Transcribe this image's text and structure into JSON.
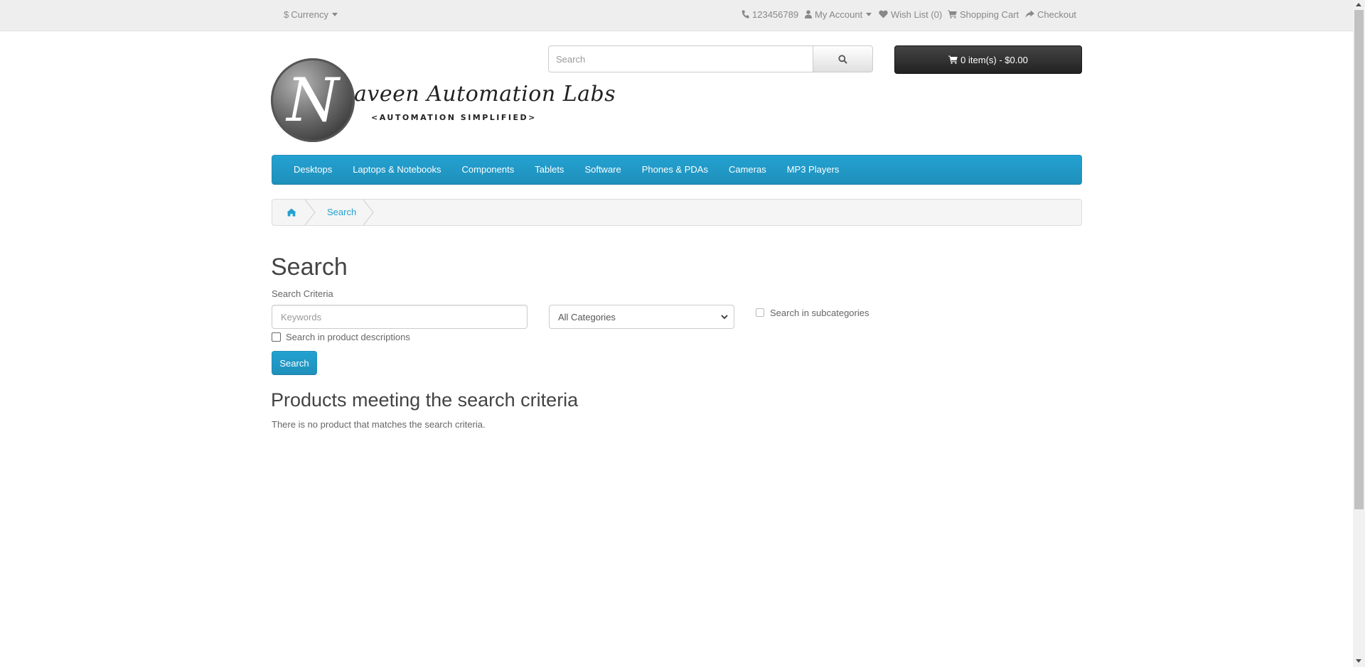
{
  "topbar": {
    "currency_symbol": "$",
    "currency_label": "Currency",
    "phone": "123456789",
    "my_account": "My Account",
    "wish_list": "Wish List (0)",
    "shopping_cart": "Shopping Cart",
    "checkout": "Checkout"
  },
  "logo": {
    "letter": "N",
    "name": "aveen Automation Labs",
    "tagline": "<AUTOMATION SIMPLIFIED>"
  },
  "header_search": {
    "placeholder": "Search",
    "button_icon": "search-icon"
  },
  "cart_button": {
    "label": "0 item(s) - $0.00",
    "icon": "shopping-cart-icon"
  },
  "menu": {
    "items": [
      {
        "label": "Desktops"
      },
      {
        "label": "Laptops & Notebooks"
      },
      {
        "label": "Components"
      },
      {
        "label": "Tablets"
      },
      {
        "label": "Software"
      },
      {
        "label": "Phones & PDAs"
      },
      {
        "label": "Cameras"
      },
      {
        "label": "MP3 Players"
      }
    ]
  },
  "breadcrumb": {
    "home_icon": "home-icon",
    "current": "Search"
  },
  "page": {
    "title": "Search",
    "criteria_label": "Search Criteria",
    "keywords_placeholder": "Keywords",
    "category_selected": "All Categories",
    "subcategories_label": "Search in subcategories",
    "subcategories_checked": false,
    "descriptions_label": "Search in product descriptions",
    "descriptions_checked": false,
    "search_button": "Search",
    "results_title": "Products meeting the search criteria",
    "no_results": "There is no product that matches the search criteria."
  },
  "colors": {
    "accent": "#23a1d1",
    "cart_button": "#333333",
    "topbar_bg": "#eeeeee"
  }
}
